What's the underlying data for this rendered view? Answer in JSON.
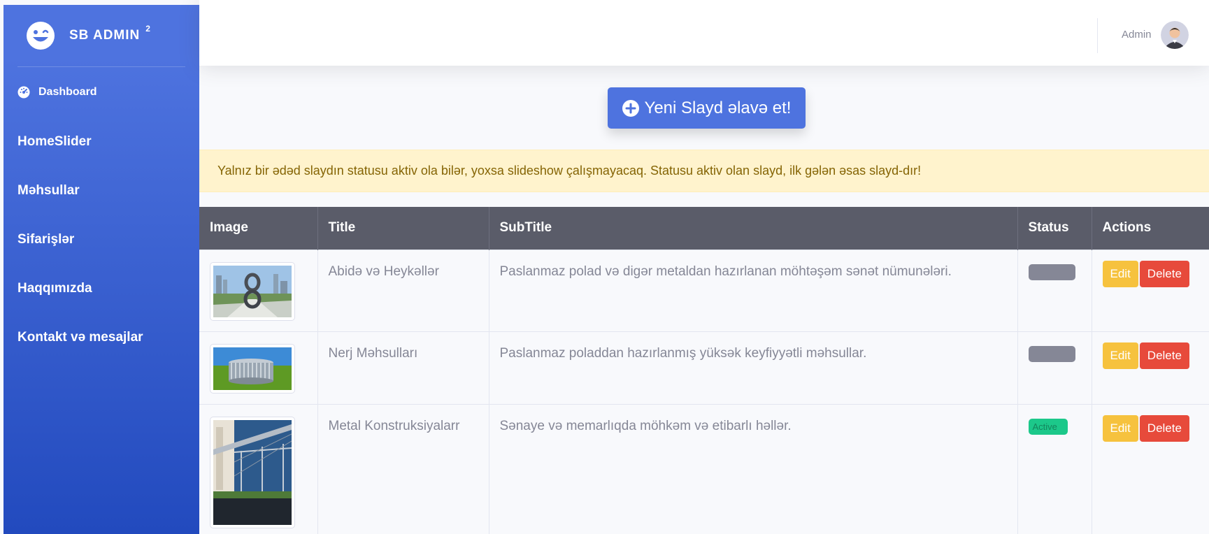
{
  "brand": {
    "name": "SB ADMIN",
    "sup": "2"
  },
  "sidebar": {
    "dashboard": "Dashboard",
    "items": [
      {
        "label": "HomeSlider"
      },
      {
        "label": "Məhsullar"
      },
      {
        "label": "Sifarişlər"
      },
      {
        "label": "Haqqımızda"
      },
      {
        "label": "Kontakt və mesajlar"
      }
    ]
  },
  "topbar": {
    "user": "Admin"
  },
  "add_button": {
    "label": "Yeni Slayd əlavə et!"
  },
  "alert": {
    "text": "Yalnız bir ədəd slaydın statusu aktiv ola bilər, yoxsa slideshow çalışmayacaq. Statusu aktiv olan slayd, ilk gələn əsas slayd-dır!"
  },
  "table": {
    "headers": [
      "Image",
      "Title",
      "SubTitle",
      "Status",
      "Actions"
    ],
    "rows": [
      {
        "title": "Abidə və Heykəllər",
        "subtitle": "Paslanmaz polad və digər metaldan hazırlanan möhtəşəm sənət nümunələri.",
        "status": "",
        "edit": "Edit",
        "delete": "Delete"
      },
      {
        "title": "Nerj Məhsulları",
        "subtitle": "Paslanmaz poladdan hazırlanmış yüksək keyfiyyətli məhsullar.",
        "status": "",
        "edit": "Edit",
        "delete": "Delete"
      },
      {
        "title": "Metal Konstruksiyalarr",
        "subtitle": "Sənaye və memarlıqda möhkəm və etibarlı həllər.",
        "status": "Active",
        "edit": "Edit",
        "delete": "Delete"
      }
    ]
  },
  "colors": {
    "primary": "#4e73df",
    "warning": "#f6c23e",
    "danger": "#e74a3b",
    "success": "#1cc88a",
    "dark": "#5a5c69"
  }
}
